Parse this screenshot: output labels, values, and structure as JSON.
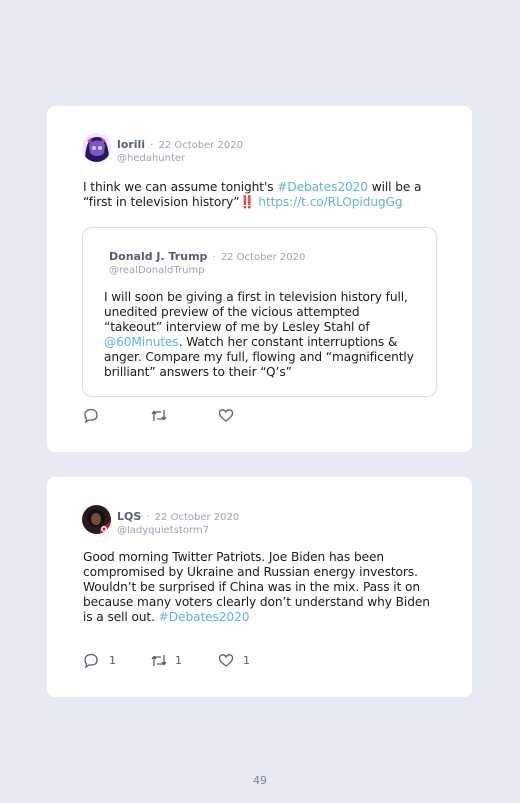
{
  "tweets": [
    {
      "name": "lorili",
      "date": "22 October 2020",
      "handle": "@hedahunter",
      "text_parts": {
        "a": "I think we can assume tonight's ",
        "hashtag": "#Debates2020",
        "b": " will be a “first in television history”",
        "bang": "‼️",
        "c": " ",
        "link": "https://t.co/RLOpidugGg"
      },
      "quoted": {
        "name": "Donald J. Trump",
        "date": "22 October 2020",
        "handle": "@realDonaldTrump",
        "text_a": "I will soon be giving a first in television history full, unedited preview of the vicious attempted “takeout” interview of me by Lesley Stahl of ",
        "mention": "@60Minutes",
        "text_b": ". Watch her constant interruptions & anger. Compare my full, flowing and “magnificently brilliant” answers to their “Q’s”"
      },
      "icons": [
        "reply-icon",
        "retweet-icon",
        "like-icon"
      ]
    },
    {
      "name": "LQS",
      "date": "22 October 2020",
      "handle": "@ladyquietstorm7",
      "text": "Good morning Twitter Patriots. Joe Biden has been compromised by Ukraine and Russian energy investors. Wouldn’t be surprised if China was in the mix. Pass it on because many voters clearly don’t understand why Biden is a sell out. ",
      "hashtag": "#Debates2020",
      "reply_count": "1",
      "retweet_count": "1",
      "like_count": "1",
      "icons": [
        "reply-icon",
        "retweet-icon",
        "like-icon"
      ]
    }
  ],
  "page_number": "49",
  "separator": "·",
  "colors": {
    "link": "#5eb3e0",
    "name": "#536173",
    "muted": "#9aa4b0",
    "background": "#e6ebf3"
  }
}
